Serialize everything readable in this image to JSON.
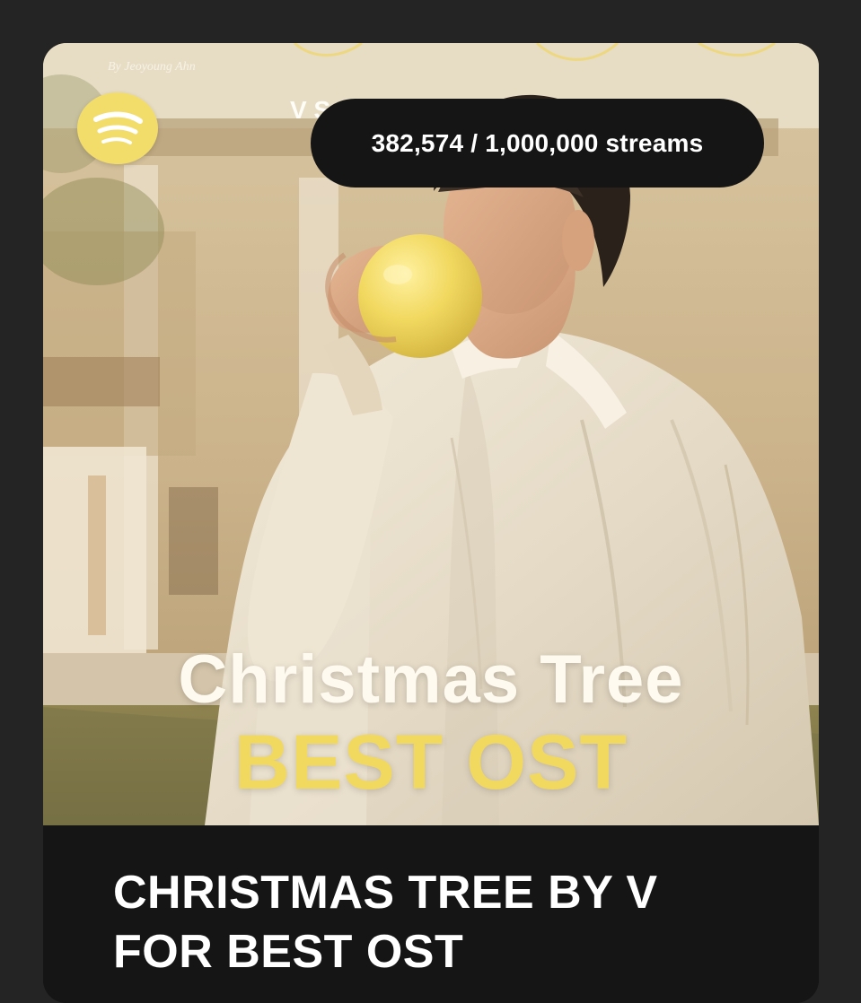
{
  "post": {
    "streams_text": "382,574 / 1,000,000 streams",
    "streams_current": 382574,
    "streams_goal": 1000000,
    "photo_title_line1": "Christmas Tree",
    "photo_title_line2": "BEST OST",
    "title_line1": "CHRISTMAS TREE BY V",
    "title_line2": "FOR BEST OST"
  },
  "icons": {
    "platform": "spotify-icon"
  },
  "colors": {
    "page_background": "#242424",
    "card_footer": "#151515",
    "accent_yellow": "#f1d85f",
    "badge_yellow": "#f3dd6a",
    "pill_background": "#151515",
    "text_white": "#ffffff"
  }
}
